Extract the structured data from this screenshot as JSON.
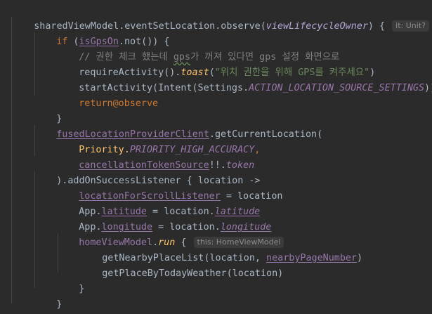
{
  "code": {
    "l1": {
      "a": "sharedViewModel",
      "b": ".eventSetLocation.observe(",
      "c": "viewLifecycleOwner",
      "d": ") {",
      "hint": "it: Unit?"
    },
    "l2": {
      "a": "if",
      "b": " (",
      "c": "isGpsOn",
      "d": ".not()) {"
    },
    "l3": {
      "a": "// 권한 체크 했는데 ",
      "b": "gps",
      "c": "가 꺼져 있다면 gps 설정 화면으로"
    },
    "l4": {
      "a": "requireActivity().",
      "b": "toast",
      "c": "(",
      "d": "\"위치 권한을 위해 GPS를 켜주세요\"",
      "e": ")"
    },
    "l5": {
      "a": "startActivity(Intent(Settings.",
      "b": "ACTION_LOCATION_SOURCE_SETTINGS",
      "c": "))"
    },
    "l6": {
      "a": "return",
      "b": "@observe"
    },
    "l7": {
      "a": "}"
    },
    "l8": {
      "a": "fusedLocationProviderClient",
      "b": ".getCurrentLocation("
    },
    "l9": {
      "a": "Priority.",
      "b": "PRIORITY_HIGH_ACCURACY",
      "c": ","
    },
    "l10": {
      "a": "cancellationTokenSource",
      "b": "!!.",
      "c": "token"
    },
    "l11": {
      "a": ").addOnSuccessListener { location ->"
    },
    "l12": {
      "a": "locationForScrollListener",
      "b": " = location"
    },
    "l13": {
      "a": "App.",
      "b": "latitude",
      "c": " = location.",
      "d": "latitude"
    },
    "l14": {
      "a": "App.",
      "b": "longitude",
      "c": " = location.",
      "d": "longitude"
    },
    "l15": {
      "a": "homeViewModel",
      "b": ".",
      "c": "run",
      "d": " {",
      "hint": "this: HomeViewModel"
    },
    "l16": {
      "a": "getNearbyPlaceList(location, ",
      "b": "nearbyPageNumber",
      "c": ")"
    },
    "l17": {
      "a": "getPlaceByTodayWeather(location)"
    },
    "l18": {
      "a": "}"
    },
    "l19": {
      "a": "}"
    },
    "l20": {
      "a": "}"
    }
  },
  "colors": {
    "background": "#2b2b2b",
    "default_text": "#a9b7c6",
    "keyword": "#cc7832",
    "property": "#9876aa",
    "function_italic": "#ffc66d",
    "string": "#6a8759",
    "comment": "#808080",
    "hint_bg": "#3b3b3b"
  }
}
